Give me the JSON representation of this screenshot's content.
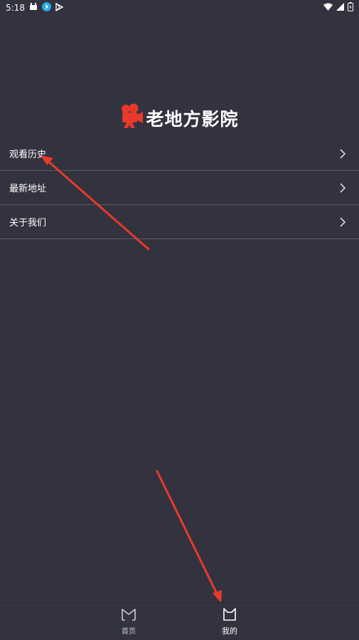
{
  "status_bar": {
    "time": "5:18"
  },
  "app": {
    "title": "老地方影院",
    "accent_color": "#e8392b"
  },
  "menu": {
    "items": [
      {
        "label": "观看历史"
      },
      {
        "label": "最新地址"
      },
      {
        "label": "关于我们"
      }
    ]
  },
  "tabbar": {
    "home_label": "首页",
    "mine_label": "我的"
  }
}
